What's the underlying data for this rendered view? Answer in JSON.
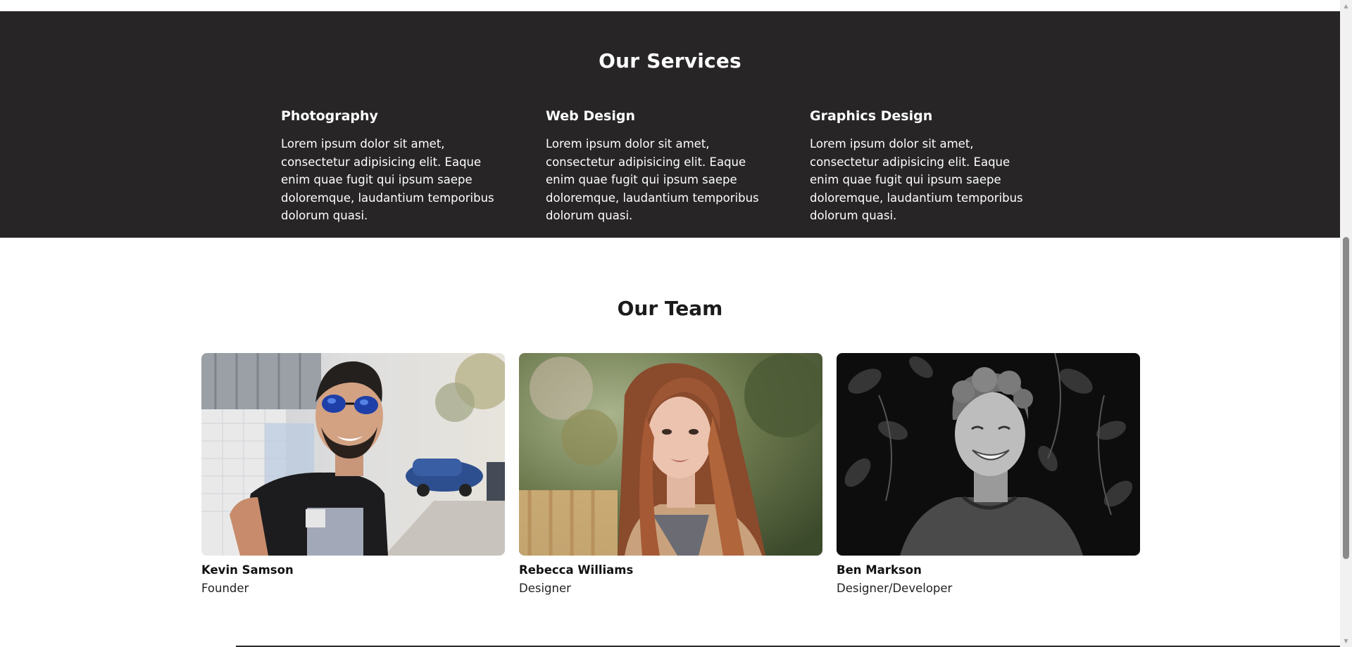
{
  "services": {
    "title": "Our Services",
    "items": [
      {
        "heading": "Photography",
        "text": "Lorem ipsum dolor sit amet, consectetur adipisicing elit. Eaque enim quae fugit qui ipsum saepe doloremque, laudantium temporibus dolorum quasi."
      },
      {
        "heading": "Web Design",
        "text": "Lorem ipsum dolor sit amet, consectetur adipisicing elit. Eaque enim quae fugit qui ipsum saepe doloremque, laudantium temporibus dolorum quasi."
      },
      {
        "heading": "Graphics Design",
        "text": "Lorem ipsum dolor sit amet, consectetur adipisicing elit. Eaque enim quae fugit qui ipsum saepe doloremque, laudantium temporibus dolorum quasi."
      }
    ]
  },
  "team": {
    "title": "Our Team",
    "members": [
      {
        "name": "Kevin Samson",
        "role": "Founder"
      },
      {
        "name": "Rebecca Williams",
        "role": "Designer"
      },
      {
        "name": "Ben Markson",
        "role": "Designer/Developer"
      }
    ]
  },
  "colors": {
    "services_bg": "#272526",
    "text_dark": "#111111",
    "page_bg": "#ffffff"
  }
}
